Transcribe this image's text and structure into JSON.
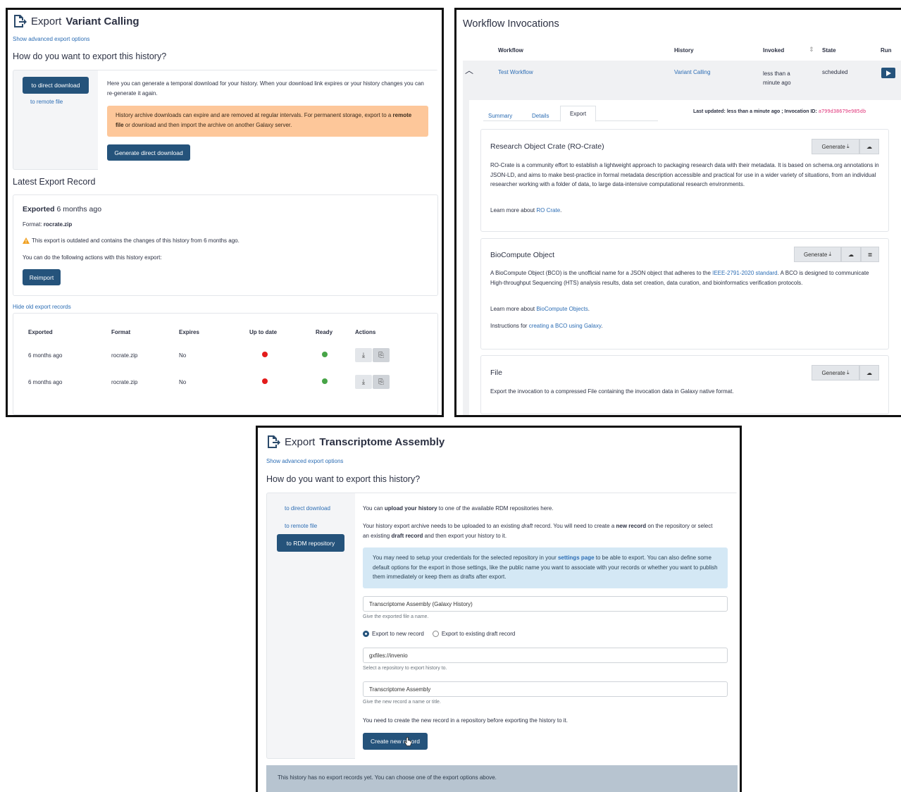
{
  "panel1": {
    "title_prefix": "Export",
    "title_bold": "Variant Calling",
    "advanced_link": "Show advanced export options",
    "question": "How do you want to export this history?",
    "tab_direct": "to direct download",
    "tab_remote": "to remote file",
    "desc": "Here you can generate a temporal download for your history. When your download link expires or your history changes you can re-generate it again.",
    "warning_a": "History archive downloads can expire and are removed at regular intervals. For permanent storage, export to a ",
    "warning_bold": "remote file",
    "warning_b": " or download and then import the archive on another Galaxy server.",
    "generate_btn": "Generate direct download",
    "latest_heading": "Latest Export Record",
    "exported_bold": "Exported",
    "exported_when": "6 months ago",
    "format_label": "Format:",
    "format_value": "rocrate.zip",
    "outdated_text": "This export is outdated and contains the changes of this history from 6 months ago.",
    "actions_text": "You can do the following actions with this history export:",
    "reimport_btn": "Reimport",
    "hide_old_link": "Hide old export records",
    "table": {
      "headers": [
        "Exported",
        "Format",
        "Expires",
        "Up to date",
        "Ready",
        "Actions"
      ],
      "rows": [
        {
          "exported": "6 months ago",
          "format": "rocrate.zip",
          "expires": "No"
        },
        {
          "exported": "6 months ago",
          "format": "rocrate.zip",
          "expires": "No"
        }
      ]
    }
  },
  "panel2": {
    "title": "Workflow Invocations",
    "headers": {
      "workflow": "Workflow",
      "history": "History",
      "invoked": "Invoked",
      "state": "State",
      "run": "Run"
    },
    "row": {
      "workflow": "Test Workflow",
      "history": "Variant Calling",
      "invoked_1": "less than a",
      "invoked_2": "minute ago",
      "state": "scheduled"
    },
    "tabs": [
      "Summary",
      "Details",
      "Export"
    ],
    "last_updated": "Last updated: less than a minute ago ; Invocation ID:",
    "invocation_id": "a799d38679e985db",
    "rocrate": {
      "title": "Research Object Crate (RO-Crate)",
      "desc": "RO-Crate is a community effort to establish a lightweight approach to packaging research data with their metadata. It is based on schema.org annotations in JSON-LD, and aims to make best-practice in formal metadata description accessible and practical for use in a wider variety of situations, from an individual researcher working with a folder of data, to large data-intensive computational research environments.",
      "learn_prefix": "Learn more about ",
      "learn_link": "RO Crate",
      "learn_suffix": "."
    },
    "bco": {
      "title": "BioCompute Object",
      "desc_a": "A BioCompute Object (BCO) is the unofficial name for a JSON object that adheres to the ",
      "desc_link": "IEEE-2791-2020 standard",
      "desc_b": ". A BCO is designed to communicate High-throughput Sequencing (HTS) analysis results, data set creation, data curation, and bioinformatics verification protocols.",
      "learn_prefix": "Learn more about ",
      "learn_link": "BioCompute Objects",
      "learn_suffix": ".",
      "instr_prefix": "Instructions for ",
      "instr_link": "creating a BCO using Galaxy",
      "instr_suffix": "."
    },
    "file": {
      "title": "File",
      "desc": "Export the invocation to a compressed File containing the invocation data in Galaxy native format."
    },
    "generate_label": "Generate"
  },
  "panel3": {
    "title_prefix": "Export",
    "title_bold": "Transcriptome Assembly",
    "advanced_link": "Show advanced export options",
    "question": "How do you want to export this history?",
    "tab_direct": "to direct download",
    "tab_remote": "to remote file",
    "tab_rdm": "to RDM repository",
    "upload_a": "You can ",
    "upload_bold": "upload your history",
    "upload_b": " to one of the available RDM repositories here.",
    "archive_a": "Your history export archive needs to be uploaded to an existing ",
    "archive_i": "draft",
    "archive_b": " record. You will need to create a ",
    "archive_bold1": "new record",
    "archive_c": " on the repository or select an existing ",
    "archive_bold2": "draft record",
    "archive_d": " and then export your history to it.",
    "info_a": "You may need to setup your credentials for the selected repository in your ",
    "info_link": "settings page",
    "info_b": " to be able to export. You can also define some default options for the export in those settings, like the public name you want to associate with your records or whether you want to publish them immediately or keep them as drafts after export.",
    "file_name_value": "Transcriptome Assembly (Galaxy History)",
    "file_name_help": "Give the exported file a name.",
    "radio_new": "Export to new record",
    "radio_existing": "Export to existing draft record",
    "repo_value": "gxfiles://invenio",
    "repo_help": "Select a repository to export history to.",
    "record_value": "Transcriptome Assembly",
    "record_help": "Give the new record a name or title.",
    "create_note": "You need to create the new record in a repository before exporting the history to it.",
    "create_btn": "Create new record",
    "no_records": "This history has no export records yet. You can choose one of the export options above."
  }
}
